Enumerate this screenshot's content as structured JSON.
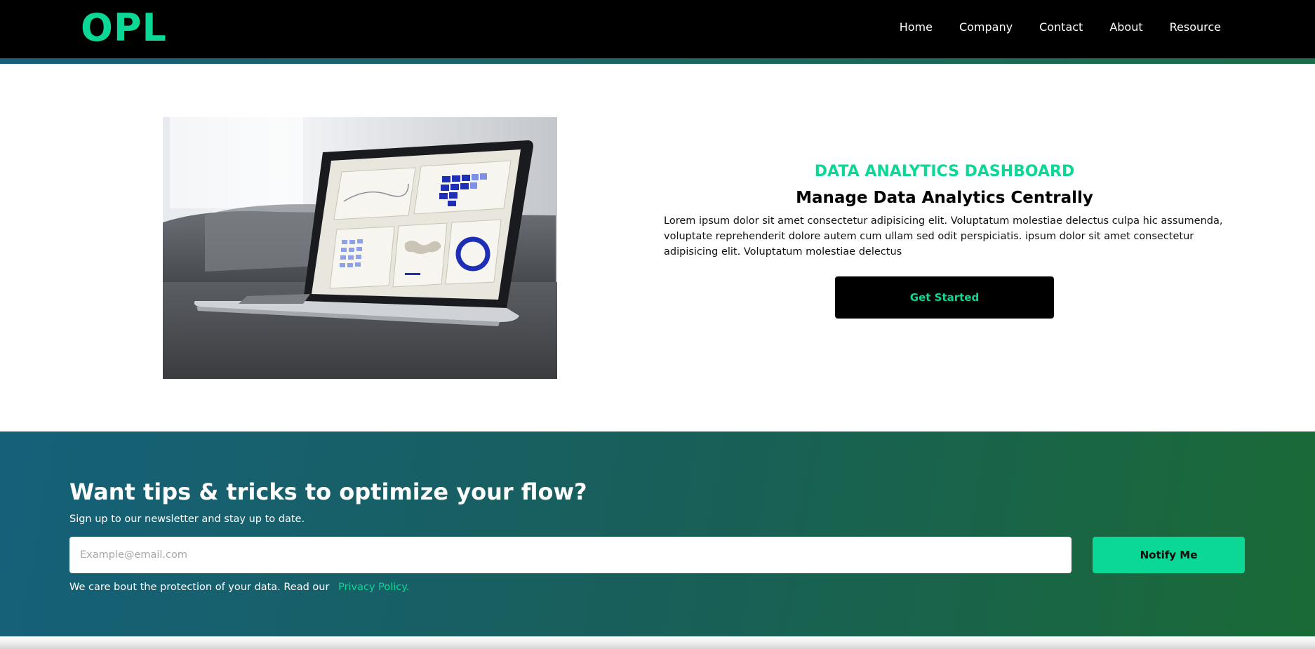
{
  "header": {
    "logo": "OPL",
    "nav": [
      "Home",
      "Company",
      "Contact",
      "About",
      "Resource"
    ]
  },
  "hero": {
    "image_label": "laptop-analytics-photo",
    "eyebrow": "DATA ANALYTICS DASHBOARD",
    "headline": "Manage Data Analytics Centrally",
    "body": "Lorem ipsum dolor sit amet consectetur adipisicing elit. Voluptatum molestiae delectus culpa hic assumenda, voluptate reprehenderit dolore autem cum ullam sed odit perspiciatis. ipsum dolor sit amet consectetur adipisicing elit. Voluptatum molestiae delectus",
    "cta": "Get Started"
  },
  "newsletter": {
    "title": "Want tips & tricks to optimize your flow?",
    "subtitle": "Sign up to our newsletter and stay up to date.",
    "email_placeholder": "Example@email.com",
    "button": "Notify Me",
    "privacy_text": "We care bout the protection of your data. Read our",
    "privacy_link": "Privacy Policy."
  },
  "colors": {
    "accent": "#0bd896",
    "header_bg": "#000000",
    "gradient_start": "#16607a",
    "gradient_end": "#1a6a36"
  }
}
